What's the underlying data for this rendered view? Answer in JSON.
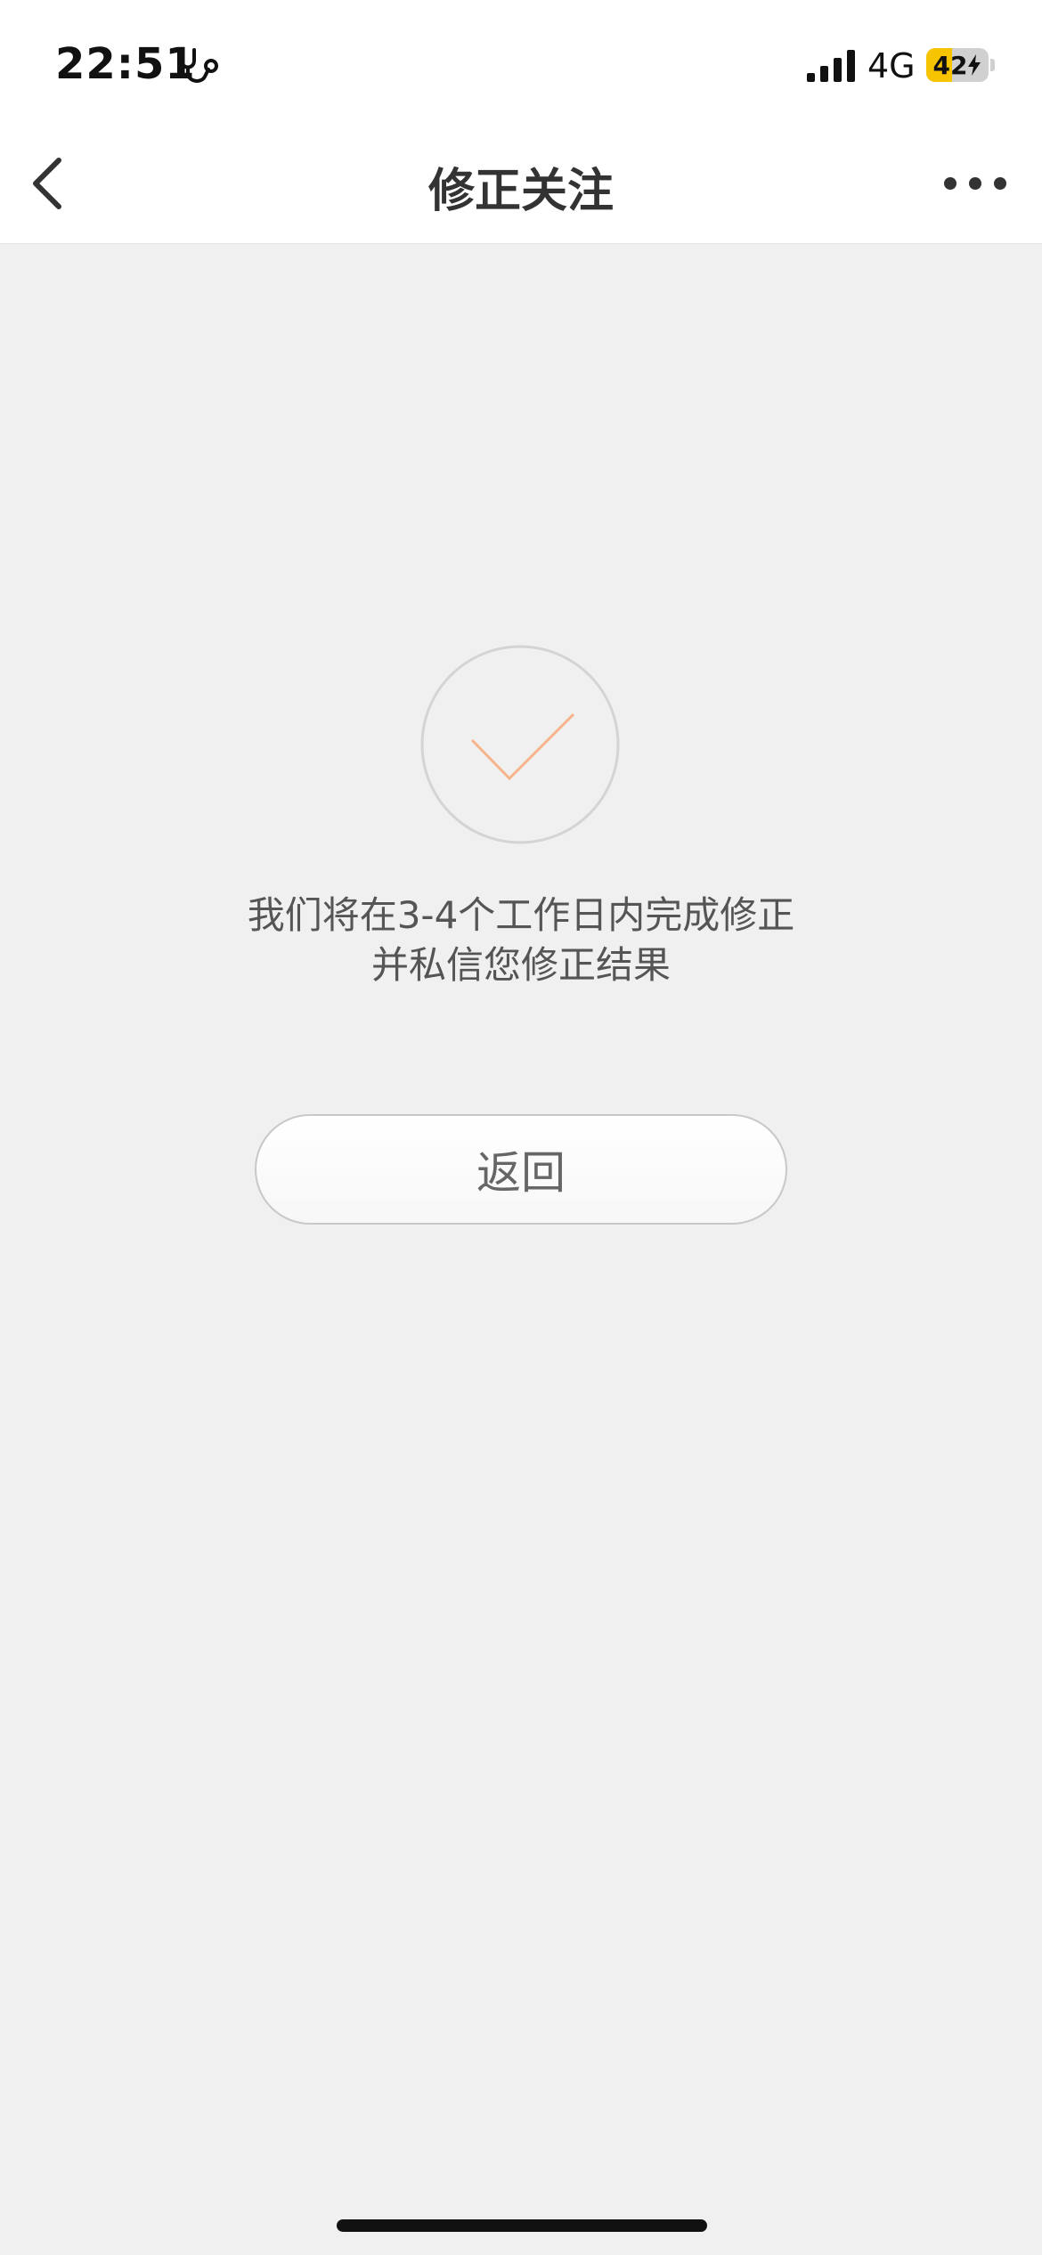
{
  "status_bar": {
    "time": "22:51",
    "health_icon": "stethoscope-icon",
    "signal_icon": "cellular-signal-icon",
    "network": "4G",
    "battery": {
      "level": "42",
      "level_percent": 42,
      "charging": true,
      "fill_color": "#f6c400"
    }
  },
  "nav": {
    "back_icon": "chevron-left-icon",
    "title": "修正关注",
    "more_icon": "more-dots-icon"
  },
  "result": {
    "icon": "checkmark-icon",
    "icon_color": "#f7b48a",
    "message_line1": "我们将在3-4个工作日内完成修正",
    "message_line2": "并私信您修正结果"
  },
  "actions": {
    "back_label": "返回"
  }
}
